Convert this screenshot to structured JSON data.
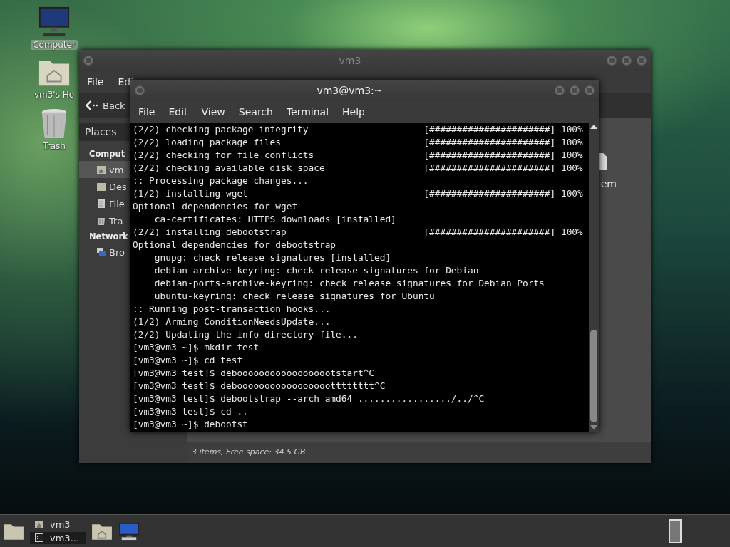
{
  "desktop_icons": [
    {
      "label": "Computer",
      "selected": true,
      "kind": "computer"
    },
    {
      "label": "vm3's Ho",
      "selected": false,
      "kind": "home"
    },
    {
      "label": "Trash",
      "selected": false,
      "kind": "trash"
    }
  ],
  "file_manager": {
    "title": "vm3",
    "menu": [
      "File",
      "Edi"
    ],
    "back": "Back",
    "sidebar": {
      "header": "Places",
      "sections": [
        {
          "title": "Comput",
          "items": [
            {
              "label": "vm",
              "selected": true,
              "kind": "home"
            },
            {
              "label": "Des",
              "selected": false,
              "kind": "folder"
            },
            {
              "label": "File",
              "selected": false,
              "kind": "drive"
            },
            {
              "label": "Tra",
              "selected": false,
              "kind": "trash"
            }
          ]
        },
        {
          "title": "Network",
          "items": [
            {
              "label": "Bro",
              "selected": false,
              "kind": "network"
            }
          ]
        }
      ]
    },
    "content_item": "em",
    "status": "3 items, Free space: 34.5 GB"
  },
  "terminal": {
    "title": "vm3@vm3:~",
    "menu": [
      "File",
      "Edit",
      "View",
      "Search",
      "Terminal",
      "Help"
    ],
    "lines": [
      {
        "text": "(2/2) checking package integrity",
        "progress": "[######################] 100%"
      },
      {
        "text": "(2/2) loading package files",
        "progress": "[######################] 100%"
      },
      {
        "text": "(2/2) checking for file conflicts",
        "progress": "[######################] 100%"
      },
      {
        "text": "(2/2) checking available disk space",
        "progress": "[######################] 100%"
      },
      {
        "text": ":: Processing package changes..."
      },
      {
        "text": "(1/2) installing wget",
        "progress": "[######################] 100%"
      },
      {
        "text": "Optional dependencies for wget"
      },
      {
        "text": "    ca-certificates: HTTPS downloads [installed]"
      },
      {
        "text": "(2/2) installing debootstrap",
        "progress": "[######################] 100%"
      },
      {
        "text": "Optional dependencies for debootstrap"
      },
      {
        "text": "    gnupg: check release signatures [installed]"
      },
      {
        "text": "    debian-archive-keyring: check release signatures for Debian"
      },
      {
        "text": "    debian-ports-archive-keyring: check release signatures for Debian Ports"
      },
      {
        "text": "    ubuntu-keyring: check release signatures for Ubuntu"
      },
      {
        "text": ":: Running post-transaction hooks..."
      },
      {
        "text": "(1/2) Arming ConditionNeedsUpdate..."
      },
      {
        "text": "(2/2) Updating the info directory file..."
      },
      {
        "text": "[vm3@vm3 ~]$ mkdir test"
      },
      {
        "text": "[vm3@vm3 ~]$ cd test"
      },
      {
        "text": "[vm3@vm3 test]$ deboooooooooooooooootstart^C"
      },
      {
        "text": "[vm3@vm3 test]$ deboooooooooooooooootttttttt^C"
      },
      {
        "text": "[vm3@vm3 test]$ debootstrap --arch amd64 ................./../^C"
      },
      {
        "text": "[vm3@vm3 test]$ cd .."
      },
      {
        "text": "[vm3@vm3 ~]$ debootst"
      }
    ]
  },
  "taskbar": {
    "tasks": [
      {
        "label": "vm3",
        "selected": false,
        "kind": "home"
      },
      {
        "label": "vm3...",
        "selected": true,
        "kind": "terminal"
      }
    ]
  }
}
